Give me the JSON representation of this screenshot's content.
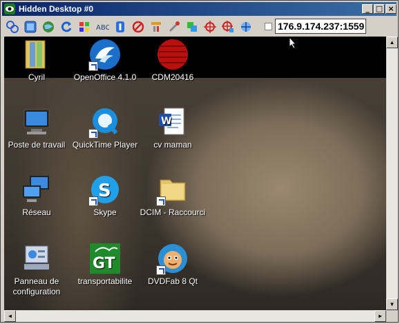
{
  "window": {
    "title": "Hidden Desktop #0",
    "minimize_glyph": "_",
    "maximize_glyph": "□",
    "close_glyph": "×"
  },
  "toolbar": {
    "buttons": [
      "connect-icon",
      "fullscreen-icon",
      "globe-icon",
      "refresh-icon",
      "windows-flag-icon",
      "text-abc-icon",
      "info-icon",
      "stop-icon",
      "tools-icon",
      "wrench-icon",
      "transfer-icon",
      "target-icon",
      "target-settings-icon",
      "network-icon"
    ],
    "address": "176.9.174.237:1559"
  },
  "desktop": {
    "icons": [
      {
        "label": "Cyril",
        "icon": "folder-icon"
      },
      {
        "label": "OpenOffice 4.1.0",
        "icon": "openoffice-icon"
      },
      {
        "label": "CDM20416",
        "icon": "cdm-icon"
      },
      {
        "label": "Poste de travail",
        "icon": "computer-icon"
      },
      {
        "label": "QuickTime Player",
        "icon": "quicktime-icon"
      },
      {
        "label": "cv maman",
        "icon": "word-doc-icon"
      },
      {
        "label": "Réseau",
        "icon": "network-computers-icon"
      },
      {
        "label": "Skype",
        "icon": "skype-icon"
      },
      {
        "label": "DCIM - Raccourci",
        "icon": "folder-shortcut-icon"
      },
      {
        "label": "Panneau de configuration",
        "icon": "control-panel-icon"
      },
      {
        "label": "transportabilite",
        "icon": "gt-icon"
      },
      {
        "label": "DVDFab 8 Qt",
        "icon": "dvdfab-icon"
      }
    ]
  },
  "scrollbars": {
    "up": "▲",
    "down": "▼",
    "left": "◄",
    "right": "►"
  },
  "colors": {
    "titlebar": "#0a246a",
    "accent": "#3a6ea5"
  }
}
